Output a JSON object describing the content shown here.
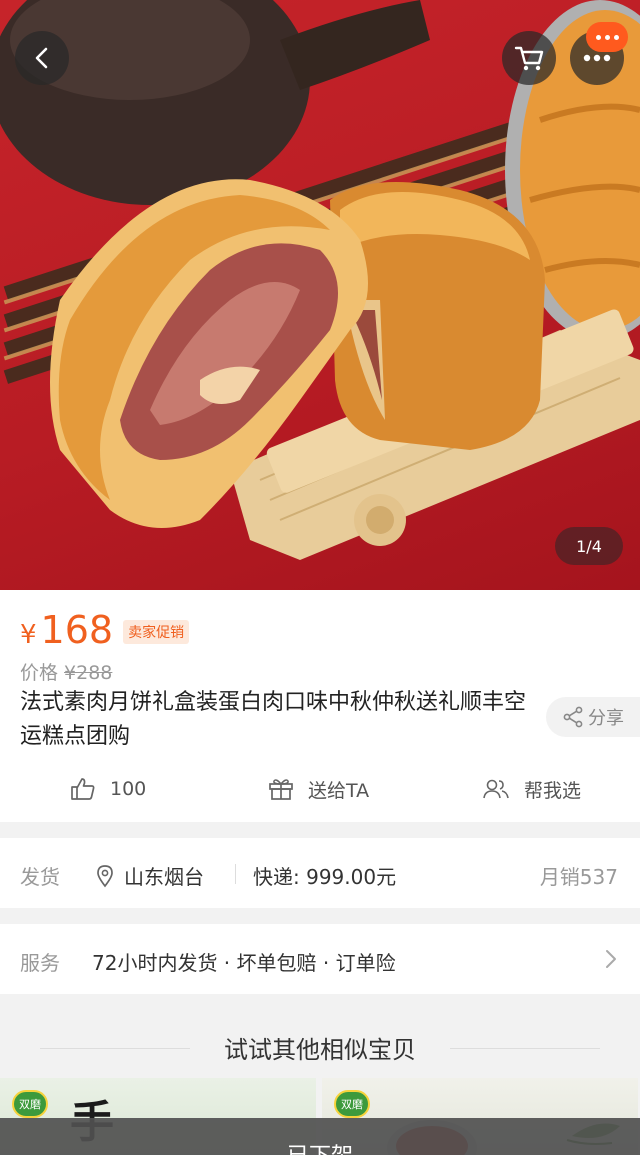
{
  "gallery": {
    "counter": "1/4"
  },
  "header_icons": {
    "back": "chevron-left-icon",
    "cart": "cart-icon",
    "more": "more-dots-icon"
  },
  "product": {
    "currency": "¥",
    "price": "168",
    "promo_tag": "卖家促销",
    "original_price_label": "价格",
    "original_price": "¥288",
    "title": "法式素肉月饼礼盒装蛋白肉口味中秋仲秋送礼顺丰空运糕点团购",
    "share_label": "分享",
    "actions": {
      "like_count": "100",
      "gift_label": "送给TA",
      "help_label": "帮我选"
    }
  },
  "shipping": {
    "label": "发货",
    "location": "山东烟台",
    "express": "快递: 999.00元",
    "monthly_sales": "月销537"
  },
  "service": {
    "label": "服务",
    "value": "72小时内发货 · 坏单包赔 · 订单险"
  },
  "similar": {
    "title": "试试其他相似宝贝",
    "thumb_a_text": "手",
    "thumb_a_logo": "双磨",
    "thumb_b_logo": "双磨"
  },
  "bottom_bar": {
    "status": "已下架"
  },
  "colors": {
    "accent": "#f0601f",
    "hero_red": "#c6242a"
  }
}
